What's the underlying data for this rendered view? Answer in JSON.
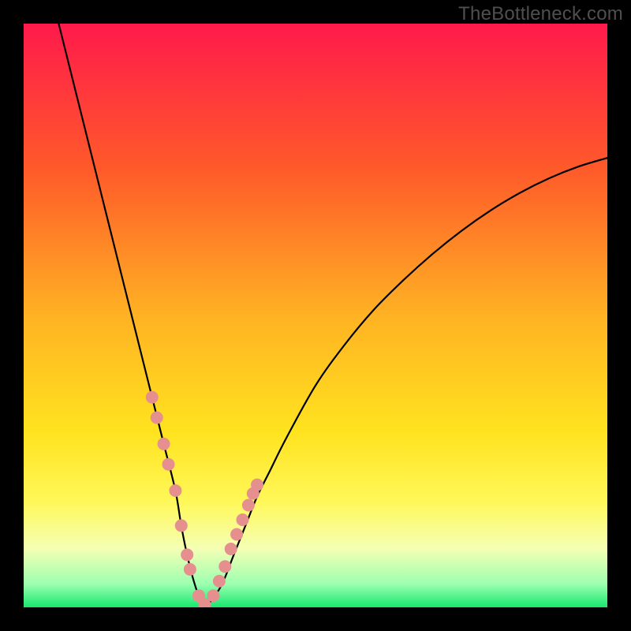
{
  "watermark": "TheBottleneck.com",
  "chart_data": {
    "type": "line",
    "title": "",
    "xlabel": "",
    "ylabel": "",
    "xlim": [
      0,
      100
    ],
    "ylim": [
      0,
      100
    ],
    "gradient_stops": [
      {
        "offset": 0,
        "color": "#ff1a4b"
      },
      {
        "offset": 25,
        "color": "#ff5a2a"
      },
      {
        "offset": 50,
        "color": "#ffb223"
      },
      {
        "offset": 70,
        "color": "#ffe31f"
      },
      {
        "offset": 82,
        "color": "#fff85a"
      },
      {
        "offset": 90,
        "color": "#f4ffb4"
      },
      {
        "offset": 96,
        "color": "#9cffb0"
      },
      {
        "offset": 100,
        "color": "#17e86f"
      }
    ],
    "series": [
      {
        "name": "bottleneck-curve",
        "type": "line",
        "x": [
          6,
          8,
          10,
          12,
          14,
          16,
          18,
          20,
          22,
          24,
          26,
          27,
          28,
          29,
          30,
          31,
          32,
          34,
          36,
          38,
          40,
          42,
          45,
          50,
          55,
          60,
          65,
          70,
          75,
          80,
          85,
          90,
          95,
          100
        ],
        "y": [
          100,
          92,
          84,
          76,
          68,
          60,
          52,
          44,
          36,
          28,
          20,
          14,
          9,
          5,
          2,
          0.5,
          1,
          4,
          9,
          14,
          19,
          23,
          29,
          38,
          45,
          51,
          56,
          60.5,
          64.5,
          68,
          71,
          73.5,
          75.5,
          77
        ]
      },
      {
        "name": "highlight-dots",
        "type": "scatter",
        "x": [
          22.0,
          22.8,
          24.0,
          24.8,
          26.0,
          27.0,
          28.0,
          28.5,
          30.0,
          31.0,
          32.5,
          33.5,
          34.5,
          35.5,
          36.5,
          37.5,
          38.5,
          39.3,
          40.0
        ],
        "y": [
          36.0,
          32.5,
          28.0,
          24.5,
          20.0,
          14.0,
          9.0,
          6.5,
          2.0,
          0.5,
          2.0,
          4.5,
          7.0,
          10.0,
          12.5,
          15.0,
          17.5,
          19.5,
          21.0
        ]
      }
    ],
    "dot_style": {
      "fill": "#e68f8f",
      "r": 8
    }
  }
}
